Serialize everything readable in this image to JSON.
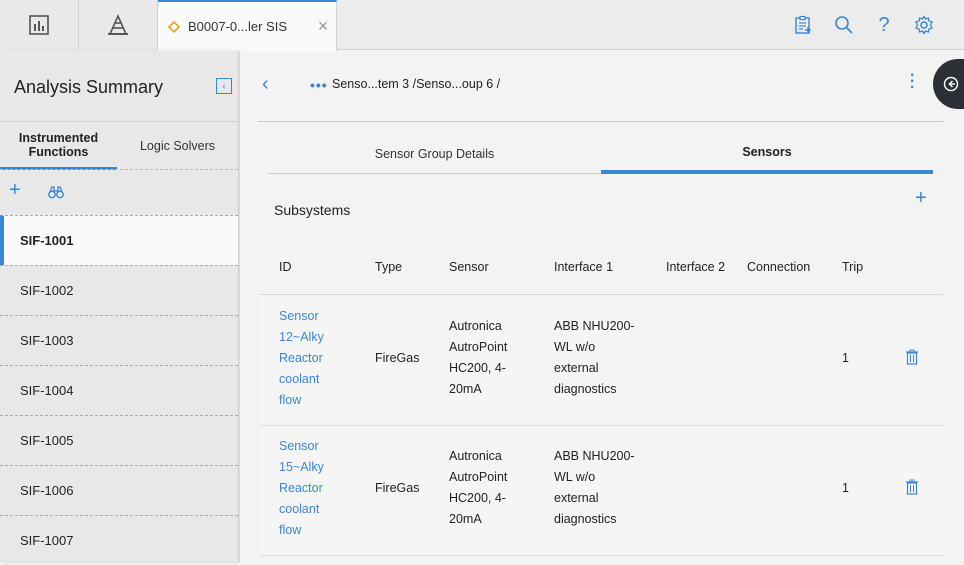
{
  "topbar": {
    "nav_icons": [
      "dashboard-icon",
      "hierarchy-icon"
    ],
    "tab": {
      "icon": "diamond-icon",
      "label": "B0007-0...ler SIS",
      "close": "×"
    },
    "right_icons": [
      "clipboard-icon",
      "search-icon",
      "help-icon",
      "gear-icon"
    ]
  },
  "left_panel": {
    "title": "Analysis Summary",
    "collapse": "‹",
    "tabs": [
      {
        "label": "Instrumented Functions",
        "active": true
      },
      {
        "label": "Logic Solvers",
        "active": false
      }
    ],
    "toolbar": {
      "add": "+",
      "find_icon": "binoculars-icon"
    },
    "items": [
      "SIF-1001",
      "SIF-1002",
      "SIF-1003",
      "SIF-1004",
      "SIF-1005",
      "SIF-1006",
      "SIF-1007"
    ],
    "selected": "SIF-1001"
  },
  "main": {
    "back": "‹",
    "breadcrumb_dots": "•••",
    "breadcrumb": "Senso...tem 3 /Senso...oup 6 /",
    "tabs": [
      {
        "label": "Sensor Group Details",
        "active": false
      },
      {
        "label": "Sensors",
        "active": true
      }
    ],
    "section_title": "Subsystems",
    "add": "+",
    "columns": [
      "ID",
      "Type",
      "Sensor",
      "Interface 1",
      "Interface 2",
      "Connection",
      "Trip"
    ],
    "rows": [
      {
        "id": [
          "Sensor",
          "12~Alky",
          "Reactor",
          "coolant",
          "flow"
        ],
        "type": "FireGas",
        "sensor": [
          "Autronica",
          "AutroPoint",
          "HC200, 4-",
          "20mA"
        ],
        "interface1": [
          "ABB NHU200-",
          "WL w/o",
          "external",
          "diagnostics"
        ],
        "interface2": "",
        "connection": "",
        "trip": "1"
      },
      {
        "id": [
          "Sensor",
          "15~Alky",
          "Reactor",
          "coolant",
          "flow"
        ],
        "type": "FireGas",
        "sensor": [
          "Autronica",
          "AutroPoint",
          "HC200, 4-",
          "20mA"
        ],
        "interface1": [
          "ABB NHU200-",
          "WL w/o",
          "external",
          "diagnostics"
        ],
        "interface2": "",
        "connection": "",
        "trip": "1"
      }
    ]
  },
  "colors": {
    "accent": "#3a86d6",
    "dark_toggle": "#2b3036"
  }
}
